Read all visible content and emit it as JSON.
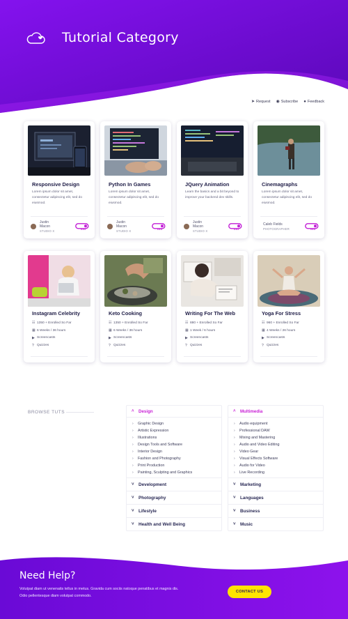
{
  "header": {
    "title": "Tutorial Category",
    "logo_icon": "cloud-heart-icon",
    "gradient": [
      "#7a10e8",
      "#a814d6"
    ]
  },
  "toolbar": {
    "request": "Request",
    "subscribe": "Subscribe",
    "feedback": "Feedback"
  },
  "courses": [
    {
      "title": "Responsive Design",
      "desc": "Lorem ipsum dolor sit amet, consectetur adipiscing elit, sed do eiusmod.",
      "author": "Justin",
      "author2": "Macon",
      "company": "STUDIO X"
    },
    {
      "title": "Python In Games",
      "desc": "Lorem ipsum dolor sit amet, consectetur adipiscing elit, sed do eiusmod.",
      "author": "Justin",
      "author2": "Macon",
      "company": "STUDIO X"
    },
    {
      "title": "JQuery Animation",
      "desc": "Learn the basics and a bit beyond to improve your backend dev skills.",
      "author": "Justin",
      "author2": "Macon",
      "company": "STUDIO X"
    },
    {
      "title": "Cinemagraphs",
      "desc": "Lorem ipsum dolor sit amet, consectetur adipiscing elit, sed do eiusmod.",
      "author": "Caleb Fields",
      "author2": "",
      "company": "PHOTOGRAPHER"
    }
  ],
  "courses2": [
    {
      "title": "Instagram Celebrity",
      "enrolled": "1350 + Enrolled So Far",
      "duration": "6 Weeks / 36 hours",
      "screencasts": "Screencasts",
      "quizzes": "Quizzes"
    },
    {
      "title": "Keto Cooking",
      "enrolled": "1350 + Enrolled So Far",
      "duration": "6 Weeks / 36 hours",
      "screencasts": "Screencasts",
      "quizzes": "Quizzes"
    },
    {
      "title": "Writing For The Web",
      "enrolled": "880 + Enrolled So Far",
      "duration": "1 Week / 6 hours",
      "screencasts": "Screencasts",
      "quizzes": "Quizzes"
    },
    {
      "title": "Yoga For Stress",
      "enrolled": "960 + Enrolled So Far",
      "duration": "4 Weeks / 26 hours",
      "screencasts": "Screencasts",
      "quizzes": "Quizzes"
    }
  ],
  "browse": {
    "label": "BROWSE TUTS",
    "left": {
      "open": "Design",
      "items": [
        "Graphic Design",
        "Artistic Expression",
        "Illustrations",
        "Design Tools and Software",
        "Interior Design",
        "Fashion and Photography",
        "Print Production",
        "Painting, Sculpting and Graphics"
      ],
      "closed": [
        "Development",
        "Photography",
        "Lifestyle",
        "Health and Well Being"
      ]
    },
    "right": {
      "open": "Multimedia",
      "items": [
        "Audio equipment",
        "Professional DAW",
        "Mixing and Mastering",
        "Audio and Video Editing",
        "Video Gear",
        "Visual Effects Software",
        "Audio for Video",
        "Live Recording"
      ],
      "closed": [
        "Marketing",
        "Languages",
        "Business",
        "Music"
      ]
    }
  },
  "footer": {
    "title": "Need Help?",
    "text": "Volutpat diam ut venenatis tellus in metus. Gravida cum sociis natoque penatibus et magnis dis. Odio pellentesque diam volutpat commodo.",
    "button": "CONTACT US"
  }
}
